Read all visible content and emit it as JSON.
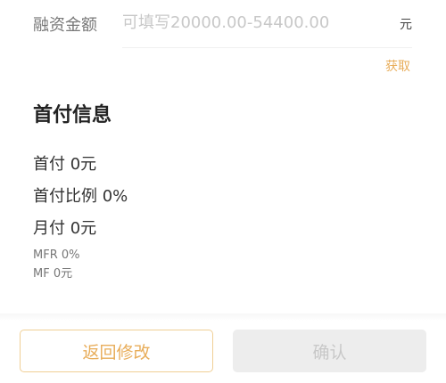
{
  "form": {
    "label": "融资金额",
    "placeholder": "可填写20000.00-54400.00",
    "value": "",
    "unit": "元",
    "fetch_label": "获取"
  },
  "down_payment": {
    "title": "首付信息",
    "items": [
      "首付 0元",
      "首付比例 0%",
      "月付 0元"
    ],
    "details": [
      "MFR 0%",
      "MF 0元"
    ]
  },
  "buttons": {
    "back": "返回修改",
    "confirm": "确认"
  }
}
